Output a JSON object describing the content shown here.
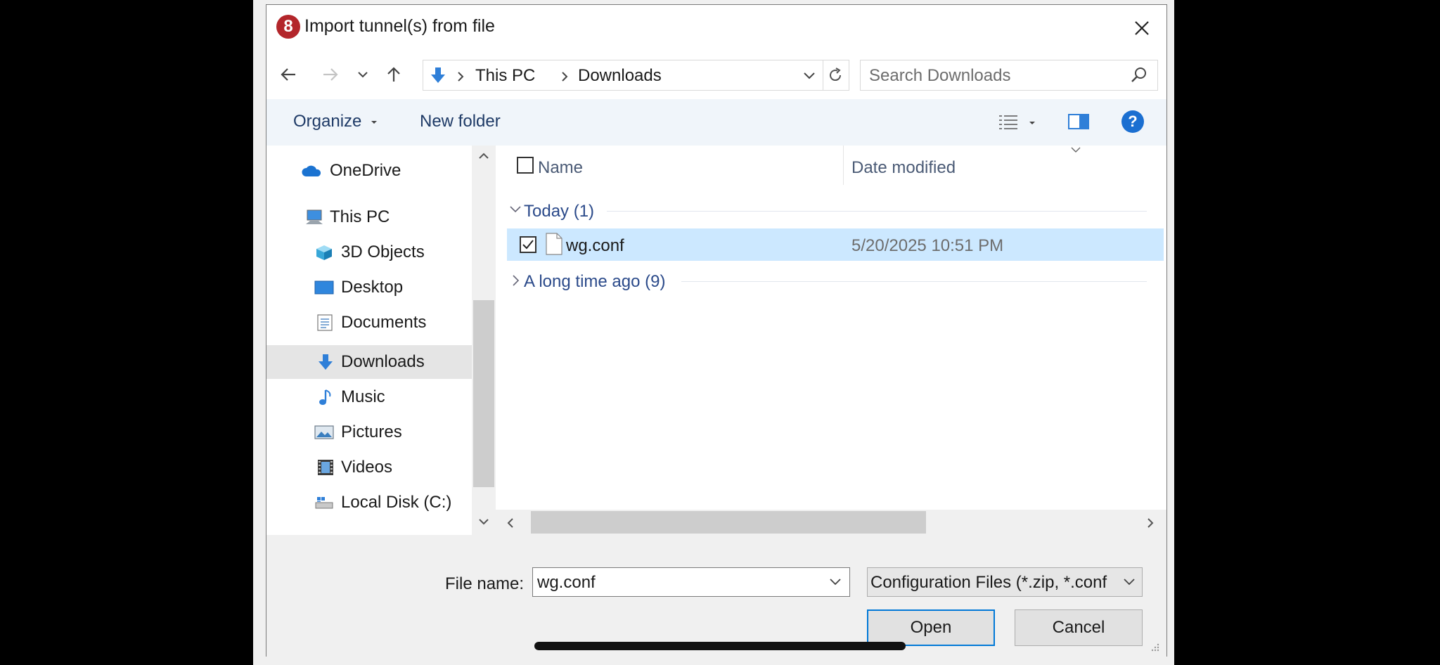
{
  "window": {
    "title": "Import tunnel(s) from file",
    "app_icon_glyph": "8"
  },
  "nav": {
    "path": [
      "This PC",
      "Downloads"
    ],
    "refresh_icon": "refresh-icon"
  },
  "search": {
    "placeholder": "Search Downloads"
  },
  "toolbar": {
    "organize_label": "Organize",
    "new_folder_label": "New folder",
    "help_glyph": "?"
  },
  "sidebar": {
    "items": [
      {
        "label": "OneDrive",
        "icon": "onedrive-icon"
      },
      {
        "label": "This PC",
        "icon": "computer-icon"
      },
      {
        "label": "3D Objects",
        "icon": "cube-icon"
      },
      {
        "label": "Desktop",
        "icon": "desktop-icon"
      },
      {
        "label": "Documents",
        "icon": "documents-icon"
      },
      {
        "label": "Downloads",
        "icon": "download-arrow-icon",
        "selected": true
      },
      {
        "label": "Music",
        "icon": "music-note-icon"
      },
      {
        "label": "Pictures",
        "icon": "pictures-icon"
      },
      {
        "label": "Videos",
        "icon": "film-icon"
      },
      {
        "label": "Local Disk (C:)",
        "icon": "drive-icon"
      }
    ]
  },
  "filelist": {
    "columns": [
      "Name",
      "Date modified"
    ],
    "groups": [
      {
        "label": "Today (1)",
        "expanded": true,
        "files": [
          {
            "name": "wg.conf",
            "date": "5/20/2025 10:51 PM",
            "selected": true,
            "checked": true
          }
        ]
      },
      {
        "label": "A long time ago (9)",
        "expanded": false,
        "files": []
      }
    ]
  },
  "footer": {
    "filename_label": "File name:",
    "filename_value": "wg.conf",
    "filter_value": "Configuration Files (*.zip, *.conf",
    "open_label": "Open",
    "cancel_label": "Cancel"
  },
  "colors": {
    "accent": "#0078d7",
    "selection": "#cce8ff",
    "link_text": "#1e3a66"
  }
}
